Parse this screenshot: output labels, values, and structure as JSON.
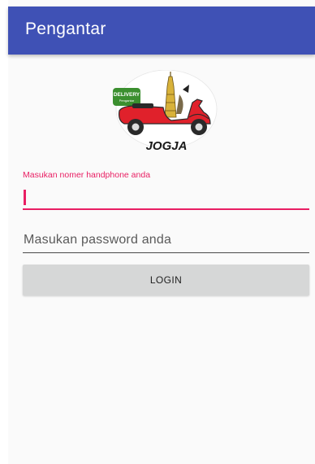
{
  "appbar": {
    "title": "Pengantar"
  },
  "logo": {
    "badge_text": "DELIVERY",
    "badge_subtext": "Pengantar",
    "brand_text": "JOGJA"
  },
  "phone_field": {
    "floating_label": "Masukan nomer handphone anda",
    "value": ""
  },
  "password_field": {
    "placeholder": "Masukan password anda",
    "value": ""
  },
  "login_button": {
    "label": "LOGIN"
  },
  "colors": {
    "primary": "#3f51b5",
    "accent": "#e91e63",
    "button": "#d6d7d7",
    "scooter": "#e0212b"
  }
}
